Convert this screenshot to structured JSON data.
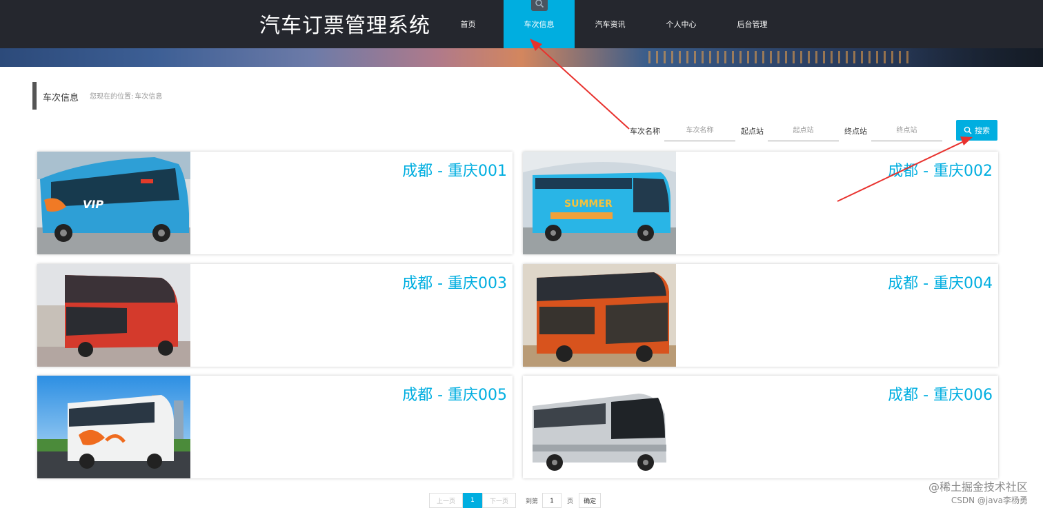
{
  "header": {
    "site_title": "汽车订票管理系统",
    "nav": [
      {
        "label": "首页"
      },
      {
        "label": "车次信息",
        "active": true
      },
      {
        "label": "汽车资讯"
      },
      {
        "label": "个人中心"
      },
      {
        "label": "后台管理"
      }
    ]
  },
  "breadcrumb": {
    "title": "车次信息",
    "prefix": "您现在的位置:",
    "current": "车次信息"
  },
  "search": {
    "fields": [
      {
        "label": "车次名称",
        "placeholder": "车次名称"
      },
      {
        "label": "起点站",
        "placeholder": "起点站"
      },
      {
        "label": "终点站",
        "placeholder": "终点站"
      }
    ],
    "button_label": "搜索"
  },
  "cards": [
    {
      "title": "成都 - 重庆001",
      "image": "blue-vip-coach"
    },
    {
      "title": "成都 - 重庆002",
      "image": "summer-tour-bus"
    },
    {
      "title": "成都 - 重庆003",
      "image": "red-double-decker"
    },
    {
      "title": "成都 - 重庆004",
      "image": "orange-double-decker"
    },
    {
      "title": "成都 - 重庆005",
      "image": "white-orange-coach"
    },
    {
      "title": "成都 - 重庆006",
      "image": "silver-coach"
    }
  ],
  "pagination": {
    "prev": "上一页",
    "current": "1",
    "next": "下一页",
    "goto_label": "到第",
    "goto_value": "1",
    "page_unit": "页",
    "confirm": "确定"
  },
  "watermark": {
    "line1": "@稀土掘金技术社区",
    "line2": "CSDN @java李杨勇"
  },
  "colors": {
    "accent": "#00aee0",
    "header_bg": "#25272e",
    "annotation": "#e8322e"
  }
}
